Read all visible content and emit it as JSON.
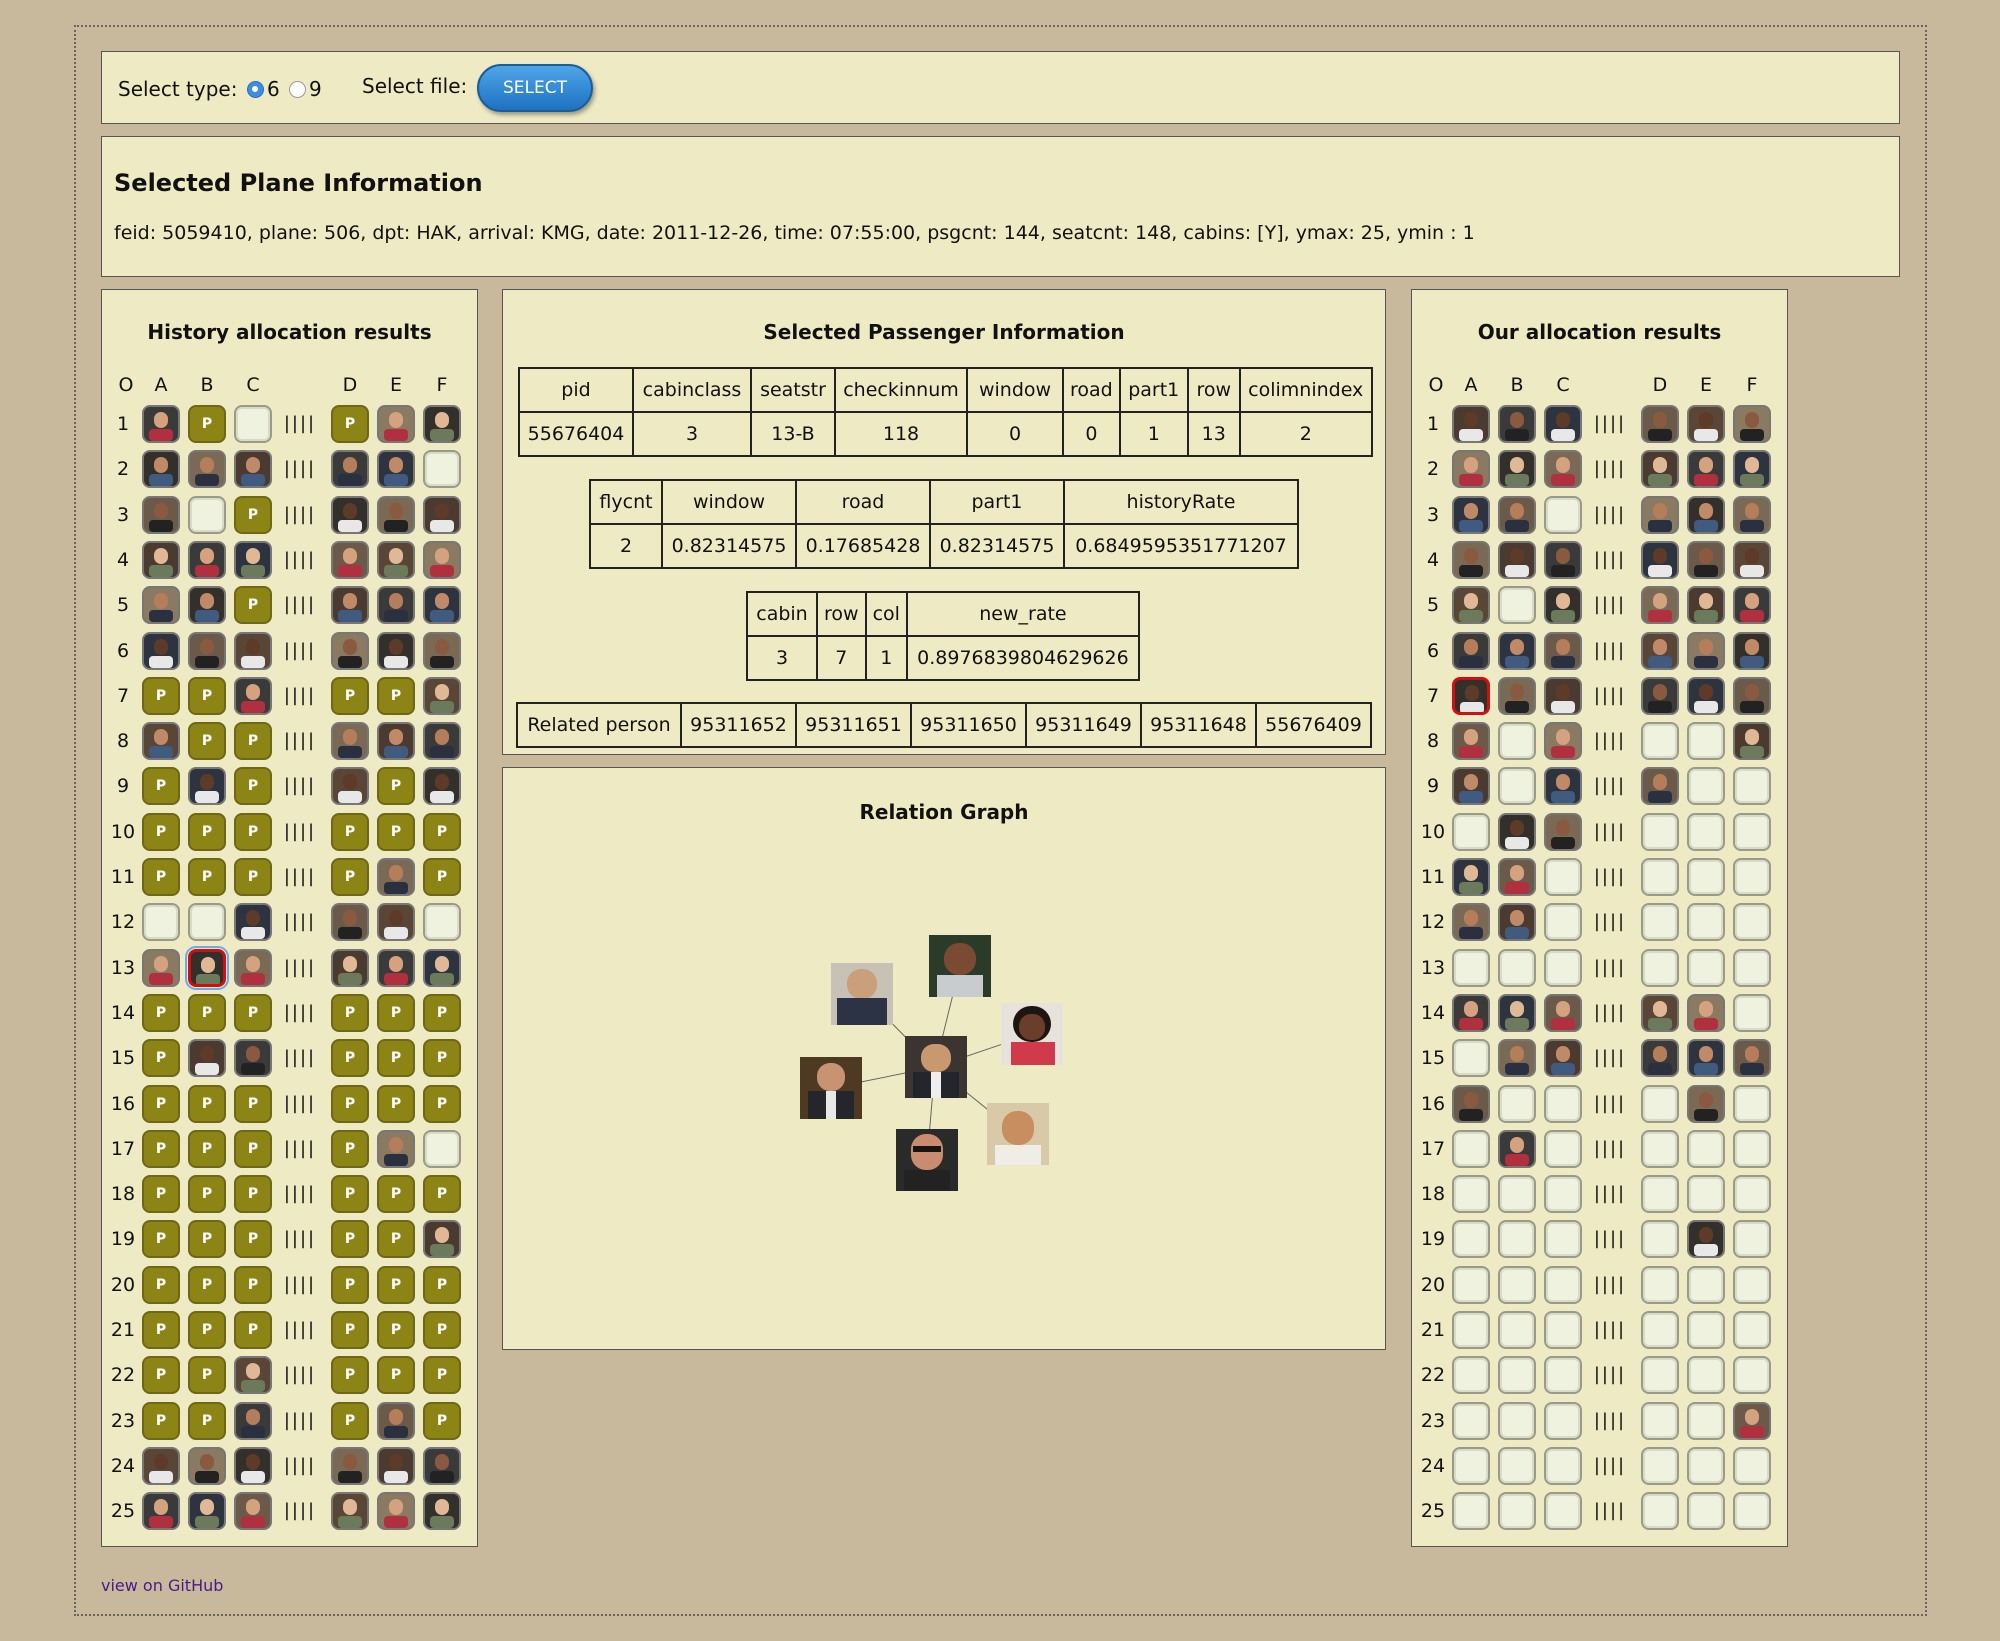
{
  "topbar": {
    "select_type_label": "Select type:",
    "type_options": [
      "6",
      "9"
    ],
    "type_selected": "6",
    "select_file_label": "Select file:",
    "select_button": "SELECT"
  },
  "plane_info": {
    "title": "Selected Plane Information",
    "line": "feid: 5059410, plane: 506, dpt: HAK, arrival: KMG, date: 2011-12-26, time: 07:55:00, psgcnt: 144, seatcnt: 148, cabins: [Y], ymax: 25, ymin : 1"
  },
  "history": {
    "title": "History allocation results",
    "columns": [
      "O",
      "A",
      "B",
      "C",
      "D",
      "E",
      "F"
    ],
    "aisle": "||||",
    "rows": [
      "FPEPFF",
      "FFFFFE",
      "FEPFFF",
      "FFFFFF",
      "FFPFFF",
      "FFFFFF",
      "PPFPPF",
      "FPPFFF",
      "PFPFPF",
      "PPPPPP",
      "PPPPFP",
      "EEFFFE",
      "FSFFFF",
      "PPPPPP",
      "PFFPPP",
      "PPPPPP",
      "PPPPFE",
      "PPPPPP",
      "PPPPPF",
      "PPPPPP",
      "PPPPPP",
      "PPFPPP",
      "PPFPFP",
      "FFFFFF",
      "FFFFFF"
    ]
  },
  "ours": {
    "title": "Our allocation results",
    "columns": [
      "O",
      "A",
      "B",
      "C",
      "D",
      "E",
      "F"
    ],
    "aisle": "||||",
    "rows": [
      "FFFFFF",
      "FFFFFF",
      "FFEFFF",
      "FFFFFF",
      "FEFFFF",
      "FFFFFF",
      "SFFFFF",
      "FEFEEF",
      "FEFFEE",
      "EFFEEE",
      "FFEEEE",
      "FFEEEE",
      "EEEEEE",
      "FFFFFE",
      "EFFFFF",
      "FEEEFE",
      "EFEEEE",
      "EEEEEE",
      "EEEEFE",
      "EEEEEE",
      "EEEEEE",
      "EEEEEE",
      "EEEEEF",
      "EEEEEE",
      "EEEEEE"
    ]
  },
  "passenger": {
    "title": "Selected Passenger Information",
    "table1": {
      "headers": [
        "pid",
        "cabinclass",
        "seatstr",
        "checkinnum",
        "window",
        "road",
        "part1",
        "row",
        "colimnindex"
      ],
      "values": [
        "55676404",
        "3",
        "13-B",
        "118",
        "0",
        "0",
        "1",
        "13",
        "2"
      ]
    },
    "table2": {
      "headers": [
        "flycnt",
        "window",
        "road",
        "part1",
        "historyRate"
      ],
      "values": [
        "2",
        "0.82314575",
        "0.17685428",
        "0.82314575",
        "0.6849595351771207"
      ]
    },
    "table3": {
      "headers": [
        "cabin",
        "row",
        "col",
        "new_rate"
      ],
      "values": [
        "3",
        "7",
        "1",
        "0.8976839804629626"
      ]
    },
    "related": {
      "label": "Related person",
      "ids": [
        "95311652",
        "95311651",
        "95311650",
        "95311649",
        "95311648",
        "55676409"
      ]
    }
  },
  "relation_graph": {
    "title": "Relation Graph"
  },
  "github_link": "view on GitHub",
  "colors": {
    "background": "#c8b89c",
    "panel": "#eeebc4",
    "occupied_P": "#8d8416",
    "selected_border": "#d01010",
    "select_button": "#2a7fd0"
  }
}
